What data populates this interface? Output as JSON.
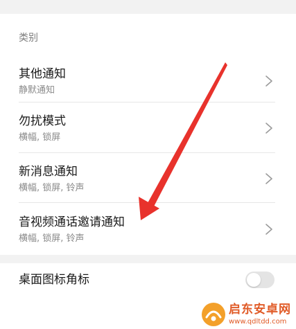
{
  "section": {
    "label": "类别"
  },
  "rows": [
    {
      "title": "其他通知",
      "subtitle": "静默通知"
    },
    {
      "title": "勿扰模式",
      "subtitle": "横幅, 锁屏"
    },
    {
      "title": "新消息通知",
      "subtitle": "横幅, 锁屏, 铃声"
    },
    {
      "title": "音视频通话邀请通知",
      "subtitle": "横幅, 锁屏, 铃声"
    }
  ],
  "toggle_setting": {
    "title": "桌面图标角标",
    "enabled": false
  },
  "annotation": {
    "arrow_color": "#e8322c"
  },
  "watermark": {
    "name": "启东安卓网",
    "url": "www.qdltdd.com"
  },
  "colors": {
    "band": "#f2f2f2",
    "divider": "#e6e6e6",
    "toggle_off": "#e4e4e4",
    "watermark": "#e05a26"
  }
}
